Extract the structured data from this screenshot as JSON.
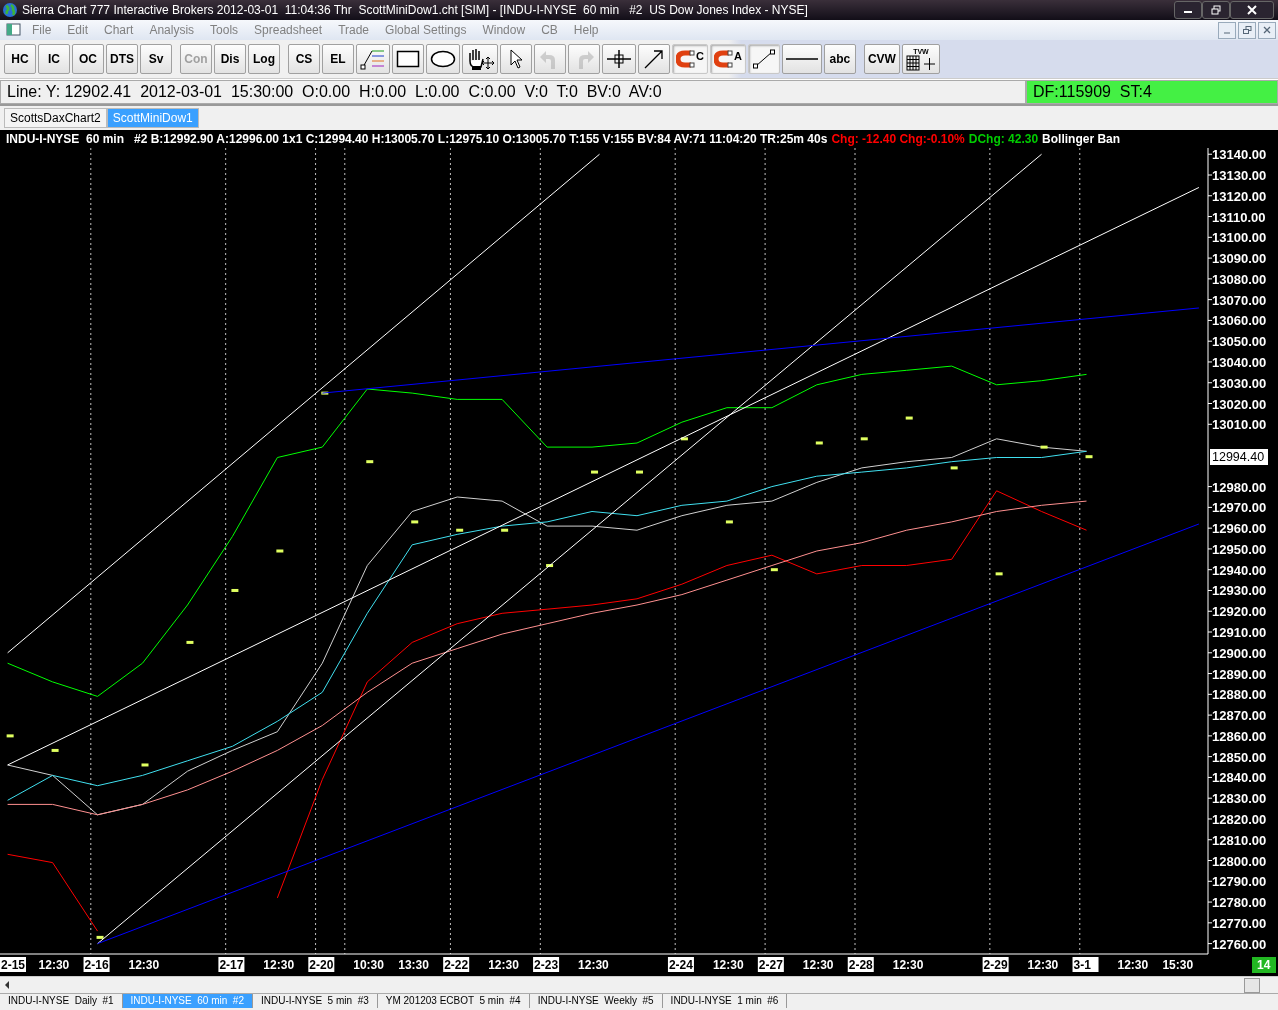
{
  "window": {
    "title": "Sierra Chart 777 Interactive Brokers 2012-03-01  11:04:36 Thr  ScottMiniDow1.cht [SIM] - [INDU-I-NYSE  60 min   #2  US Dow Jones Index - NYSE]"
  },
  "menu": [
    "File",
    "Edit",
    "Chart",
    "Analysis",
    "Tools",
    "Spreadsheet",
    "Trade",
    "Global Settings",
    "Window",
    "CB",
    "Help"
  ],
  "toolbar": [
    {
      "kind": "text",
      "label": "HC",
      "disabled": false,
      "pressed": false
    },
    {
      "kind": "text",
      "label": "IC",
      "disabled": false,
      "pressed": false
    },
    {
      "kind": "text",
      "label": "OC",
      "disabled": false,
      "pressed": false
    },
    {
      "kind": "text",
      "label": "DTS",
      "disabled": false,
      "pressed": false
    },
    {
      "kind": "text",
      "label": "Sv",
      "disabled": false,
      "pressed": false
    },
    {
      "kind": "separator"
    },
    {
      "kind": "text",
      "label": "Con",
      "disabled": true,
      "pressed": false
    },
    {
      "kind": "text",
      "label": "Dis",
      "disabled": false,
      "pressed": false
    },
    {
      "kind": "text",
      "label": "Log",
      "disabled": false,
      "pressed": false
    },
    {
      "kind": "separator"
    },
    {
      "kind": "text",
      "label": "CS",
      "disabled": false,
      "pressed": false
    },
    {
      "kind": "text",
      "label": "EL",
      "disabled": false,
      "pressed": false
    },
    {
      "kind": "fib",
      "disabled": false,
      "pressed": false
    },
    {
      "kind": "rect",
      "disabled": false,
      "pressed": false
    },
    {
      "kind": "ellipse",
      "disabled": false,
      "pressed": false
    },
    {
      "kind": "hand",
      "disabled": false,
      "pressed": false
    },
    {
      "kind": "pointer",
      "disabled": false,
      "pressed": false
    },
    {
      "kind": "undo",
      "disabled": true,
      "pressed": false
    },
    {
      "kind": "redo",
      "disabled": true,
      "pressed": false
    },
    {
      "kind": "crosshair",
      "disabled": false,
      "pressed": false
    },
    {
      "kind": "arrow",
      "disabled": false,
      "pressed": false
    },
    {
      "kind": "magnet",
      "label": "C",
      "disabled": false,
      "pressed": true
    },
    {
      "kind": "magnet",
      "label": "A",
      "disabled": false,
      "pressed": true
    },
    {
      "kind": "segment",
      "disabled": false,
      "pressed": true
    },
    {
      "kind": "hline",
      "disabled": false,
      "pressed": false
    },
    {
      "kind": "text",
      "label": "abc",
      "disabled": false,
      "pressed": false
    },
    {
      "kind": "separator"
    },
    {
      "kind": "text",
      "label": "CVW",
      "disabled": false,
      "pressed": false
    },
    {
      "kind": "table",
      "label": "TVW",
      "disabled": false,
      "pressed": false
    }
  ],
  "info_line": {
    "text": "Line: Y: 12902.41  2012-03-01  15:30:00  O:0.00  H:0.00  L:0.00  C:0.00  V:0  T:0  BV:0  AV:0",
    "status": "DF:115909  ST:4"
  },
  "chart_tabs": [
    {
      "label": "ScottsDaxChart2",
      "selected": false
    },
    {
      "label": "ScottMiniDow1",
      "selected": true
    }
  ],
  "chart": {
    "header": [
      {
        "text": "INDU-I-NYSE  60 min   #2 B:12992.90 A:12996.00 1x1 C:12994.40 H:13005.70 L:12975.10 O:13005.70 T:155 V:155 BV:84 AV:71 11:04:20 TR:25m 40s",
        "color": "#ffffff"
      },
      {
        "text": "Chg: -12.40 Chg:-0.10%",
        "color": "#ff0000"
      },
      {
        "text": "DChg: 42.30",
        "color": "#00cc00"
      },
      {
        "text": "Bollinger Ban",
        "color": "#ffffff"
      }
    ],
    "price_label": "12994.40",
    "corner_badge": "14",
    "chart_data": {
      "type": "line",
      "categories": [
        "2-15",
        "12:30",
        "2-16",
        "12:30",
        null,
        "2-17",
        "12:30",
        "2-20",
        "10:30",
        "13:30",
        "2-22",
        "12:30",
        "2-23",
        "12:30",
        null,
        "2-24",
        "12:30",
        "2-27",
        "12:30",
        "2-28",
        "12:30",
        null,
        "2-29",
        "12:30",
        "3-1",
        "12:30",
        "15:30"
      ],
      "series": [
        {
          "color": "#00ff00",
          "values": [
            12895,
            12886,
            12879,
            12895,
            12923,
            12956,
            12994,
            12999,
            13027,
            13025,
            13022,
            13022,
            12999,
            12999,
            13001,
            13011,
            13018,
            13018,
            13029,
            13034,
            13036,
            13038,
            13029,
            13031,
            13034,
            null,
            null
          ]
        },
        {
          "color": "#ff0000",
          "values": [
            12803,
            12799,
            12766,
            null,
            null,
            null,
            12782,
            12839,
            12886,
            12905,
            12914,
            12919,
            12921,
            12923,
            12926,
            12933,
            12942,
            12947,
            12938,
            12942,
            12942,
            12945,
            12978,
            12968,
            12959,
            null,
            null
          ]
        },
        {
          "color": "#d0d0d0",
          "values": [
            12846,
            12841,
            12822,
            12827,
            12843,
            12853,
            12862,
            12895,
            12942,
            12968,
            12975,
            12973,
            12961,
            12961,
            12959,
            12966,
            12971,
            12973,
            12982,
            12989,
            12992,
            12994,
            13003,
            12999,
            12997,
            null,
            null
          ]
        },
        {
          "color": "#40e0f0",
          "values": [
            12829,
            12841,
            12836,
            12841,
            12848,
            12855,
            12867,
            12881,
            12919,
            12952,
            12957,
            12961,
            12963,
            12968,
            12966,
            12971,
            12973,
            12980,
            12985,
            12987,
            12989,
            12992,
            12994,
            12994,
            12997,
            null,
            null
          ]
        },
        {
          "color": "#ff9090",
          "values": [
            12827,
            12827,
            12822,
            12827,
            12834,
            12843,
            12853,
            12865,
            12881,
            12895,
            12902,
            12909,
            12914,
            12919,
            12923,
            12928,
            12935,
            12942,
            12949,
            12953,
            12959,
            12963,
            12968,
            12971,
            12973,
            null,
            null
          ]
        }
      ],
      "ylim": [
        12755,
        13143
      ],
      "yticks": [
        {
          "value": 12760,
          "label": "12760.00"
        },
        {
          "value": 12770,
          "label": "12770.00"
        },
        {
          "value": 12780,
          "label": "12780.00"
        },
        {
          "value": 12790,
          "label": "12790.00"
        },
        {
          "value": 12800,
          "label": "12800.00"
        },
        {
          "value": 12810,
          "label": "12810.00"
        },
        {
          "value": 12820,
          "label": "12820.00"
        },
        {
          "value": 12830,
          "label": "12830.00"
        },
        {
          "value": 12840,
          "label": "12840.00"
        },
        {
          "value": 12850,
          "label": "12850.00"
        },
        {
          "value": 12860,
          "label": "12860.00"
        },
        {
          "value": 12870,
          "label": "12870.00"
        },
        {
          "value": 12880,
          "label": "12880.00"
        },
        {
          "value": 12890,
          "label": "12890.00"
        },
        {
          "value": 12900,
          "label": "12900.00"
        },
        {
          "value": 12910,
          "label": "12910.00"
        },
        {
          "value": 12920,
          "label": "12920.00"
        },
        {
          "value": 12930,
          "label": "12930.00"
        },
        {
          "value": 12940,
          "label": "12940.00"
        },
        {
          "value": 12950,
          "label": "12950.00"
        },
        {
          "value": 12960,
          "label": "12960.00"
        },
        {
          "value": 12970,
          "label": "12970.00"
        },
        {
          "value": 12980,
          "label": "12980.00"
        },
        {
          "value": 13010,
          "label": "13010.00"
        },
        {
          "value": 13020,
          "label": "13020.00"
        },
        {
          "value": 13030,
          "label": "13030.00"
        },
        {
          "value": 13040,
          "label": "13040.00"
        },
        {
          "value": 13050,
          "label": "13050.00"
        },
        {
          "value": 13060,
          "label": "13060.00"
        },
        {
          "value": 13070,
          "label": "13070.00"
        },
        {
          "value": 13080,
          "label": "13080.00"
        },
        {
          "value": 13090,
          "label": "13090.00"
        },
        {
          "value": 13100,
          "label": "13100.00"
        },
        {
          "value": 13110,
          "label": "13110.00"
        },
        {
          "value": 13120,
          "label": "13120.00"
        },
        {
          "value": 13130,
          "label": "13130.00"
        },
        {
          "value": 13140,
          "label": "13140.00"
        }
      ],
      "grid": true
    }
  },
  "bottom_tabs": [
    {
      "label": "INDU-I-NYSE  Daily  #1",
      "selected": false
    },
    {
      "label": "INDU-I-NYSE  60 min  #2",
      "selected": true
    },
    {
      "label": "INDU-I-NYSE  5 min  #3",
      "selected": false
    },
    {
      "label": "YM 201203 ECBOT  5 min  #4",
      "selected": false
    },
    {
      "label": "INDU-I-NYSE  Weekly  #5",
      "selected": false
    },
    {
      "label": "INDU-I-NYSE  1 min  #6",
      "selected": false
    }
  ]
}
